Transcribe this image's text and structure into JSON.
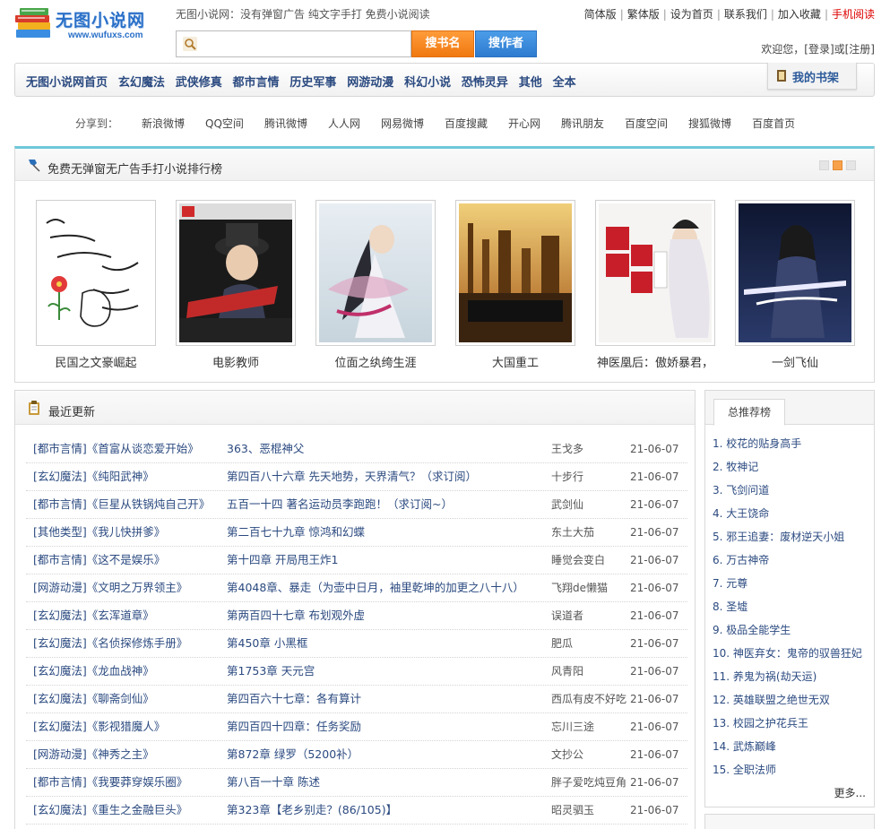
{
  "header": {
    "logo_title": "无图小说网",
    "logo_url": "www.wufuxs.com",
    "slogan": "无图小说网：没有弹窗广告 纯文字手打 免费小说阅读",
    "top_links": [
      "简体版",
      "繁体版",
      "设为首页",
      "联系我们",
      "加入收藏",
      "手机阅读"
    ],
    "search_placeholder": "",
    "search_book_label": "搜书名",
    "search_author_label": "搜作者",
    "welcome": "欢迎您，[登录]或[注册]"
  },
  "nav": {
    "items": [
      "无图小说网首页",
      "玄幻魔法",
      "武侠修真",
      "都市言情",
      "历史军事",
      "网游动漫",
      "科幻小说",
      "恐怖灵异",
      "其他",
      "全本"
    ],
    "bookshelf_label": "我的书架"
  },
  "share": {
    "label": "分享到：",
    "items": [
      "新浪微博",
      "QQ空间",
      "腾讯微博",
      "人人网",
      "网易微博",
      "百度搜藏",
      "开心网",
      "腾讯朋友",
      "百度空间",
      "搜狐微博",
      "百度首页"
    ]
  },
  "ranking": {
    "title": "免费无弹窗无广告手打小说排行榜",
    "books": [
      {
        "name": "民国之文豪崛起"
      },
      {
        "name": "电影教师"
      },
      {
        "name": "位面之纨绔生涯"
      },
      {
        "name": "大国重工"
      },
      {
        "name": "神医凰后：傲娇暴君，"
      },
      {
        "name": "一剑飞仙"
      }
    ]
  },
  "latest": {
    "title": "最近更新",
    "rows": [
      {
        "cat": "[都市言情]《首富从谈恋爱开始》",
        "chapter": "363、恶棍神父",
        "author": "王戈多",
        "date": "21-06-07"
      },
      {
        "cat": "[玄幻魔法]《纯阳武神》",
        "chapter": "第四百八十六章 先天地势，天界清气？（求订阅）",
        "author": "十步行",
        "date": "21-06-07"
      },
      {
        "cat": "[都市言情]《巨星从铁锅炖自己开》",
        "chapter": "五百一十四 著名运动员李跑跑！（求订阅~）",
        "author": "武剑仙",
        "date": "21-06-07"
      },
      {
        "cat": "[其他类型]《我儿快拼爹》",
        "chapter": "第二百七十九章 惊鸿和幻蝶",
        "author": "东土大茄",
        "date": "21-06-07"
      },
      {
        "cat": "[都市言情]《这不是娱乐》",
        "chapter": "第十四章 开局甩王炸1",
        "author": "睡觉会变白",
        "date": "21-06-07"
      },
      {
        "cat": "[网游动漫]《文明之万界领主》",
        "chapter": "第4048章、暴走（为壶中日月，袖里乾坤的加更之八十八）",
        "author": "飞翔de懒猫",
        "date": "21-06-07"
      },
      {
        "cat": "[玄幻魔法]《玄浑道章》",
        "chapter": "第两百四十七章 布划观外虚",
        "author": "误道者",
        "date": "21-06-07"
      },
      {
        "cat": "[玄幻魔法]《名侦探修炼手册》",
        "chapter": "第450章 小黑框",
        "author": "肥瓜",
        "date": "21-06-07"
      },
      {
        "cat": "[玄幻魔法]《龙血战神》",
        "chapter": "第1753章 天元宫",
        "author": "风青阳",
        "date": "21-06-07"
      },
      {
        "cat": "[玄幻魔法]《聊斋剑仙》",
        "chapter": "第四百六十七章：各有算计",
        "author": "西瓜有皮不好吃",
        "date": "21-06-07"
      },
      {
        "cat": "[玄幻魔法]《影视猎魔人》",
        "chapter": "第四百四十四章：任务奖励",
        "author": "忘川三途",
        "date": "21-06-07"
      },
      {
        "cat": "[网游动漫]《神秀之主》",
        "chapter": "第872章 绿罗（5200补）",
        "author": "文抄公",
        "date": "21-06-07"
      },
      {
        "cat": "[都市言情]《我要莽穿娱乐圈》",
        "chapter": "第八百一十章 陈述",
        "author": "胖子爱吃炖豆角",
        "date": "21-06-07"
      },
      {
        "cat": "[玄幻魔法]《重生之金融巨头》",
        "chapter": "第323章【老乡别走？(86/105)】",
        "author": "昭灵驷玉",
        "date": "21-06-07"
      }
    ]
  },
  "recommend": {
    "tab": "总推荐榜",
    "items": [
      "1. 校花的贴身高手",
      "2. 牧神记",
      "3. 飞剑问道",
      "4. 大王饶命",
      "5. 邪王追妻：废材逆天小姐",
      "6. 万古神帝",
      "7. 元尊",
      "8. 圣墟",
      "9. 极品全能学生",
      "10. 神医弃女：鬼帝的驭兽狂妃",
      "11. 养鬼为祸(劫天运)",
      "12. 英雄联盟之绝世无双",
      "13. 校园之护花兵王",
      "14. 武炼巅峰",
      "15. 全职法师"
    ],
    "more": "更多..."
  }
}
